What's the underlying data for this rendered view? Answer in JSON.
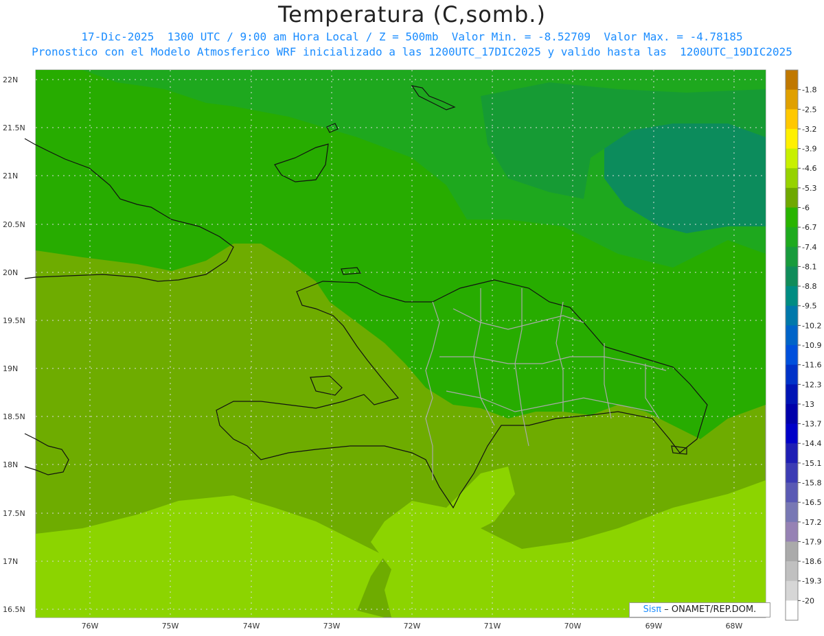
{
  "header": {
    "title": "Temperatura (C,somb.)",
    "line1": "17-Dic-2025  1300 UTC / 9:00 am Hora Local / Z = 500mb  Valor Min. = -8.52709  Valor Max. = -4.78185",
    "line2": "Pronostico con el Modelo Atmosferico WRF inicializado a las 1200UTC_17DIC2025 y valido hasta las  1200UTC_19DIC2025"
  },
  "axes": {
    "lat_labels": [
      "22N",
      "21.5N",
      "21N",
      "20.5N",
      "20N",
      "19.5N",
      "19N",
      "18.5N",
      "18N",
      "17.5N",
      "17N",
      "16.5N"
    ],
    "lon_labels": [
      "76W",
      "75W",
      "74W",
      "73W",
      "72W",
      "71W",
      "70W",
      "69W",
      "68W"
    ]
  },
  "colorbar": {
    "levels": [
      "-1.8",
      "-2.5",
      "-3.2",
      "-3.9",
      "-4.6",
      "-5.3",
      "-6",
      "-6.7",
      "-7.4",
      "-8.1",
      "-8.8",
      "-9.5",
      "-10.2",
      "-10.9",
      "-11.6",
      "-12.3",
      "-13",
      "-13.7",
      "-14.4",
      "-15.1",
      "-15.8",
      "-16.5",
      "-17.2",
      "-17.9",
      "-18.6",
      "-19.3",
      "-20"
    ],
    "colors": [
      "#c07800",
      "#e0a000",
      "#ffc800",
      "#fff000",
      "#c8f000",
      "#96d200",
      "#6ea800",
      "#28b400",
      "#1eaa1e",
      "#189b3c",
      "#108c5a",
      "#008c82",
      "#0078aa",
      "#0064c8",
      "#0050dc",
      "#0032c8",
      "#0014b4",
      "#0000aa",
      "#0000c8",
      "#1e1eb4",
      "#3c3cb4",
      "#5a5ab4",
      "#7878b4",
      "#9682b4",
      "#aaaaaa",
      "#c0c0c0",
      "#d6d6d6",
      "#ffffff"
    ]
  },
  "fields": {
    "c_warm": "#8cd400",
    "c_mid": "#6eac00",
    "c_cool": "#27ac00",
    "c_cooler": "#169b34",
    "c_coolest": "#0c8c5c"
  },
  "credit": {
    "brand": "Sisπ",
    "text": "– ONAMET/REP.DOM."
  }
}
